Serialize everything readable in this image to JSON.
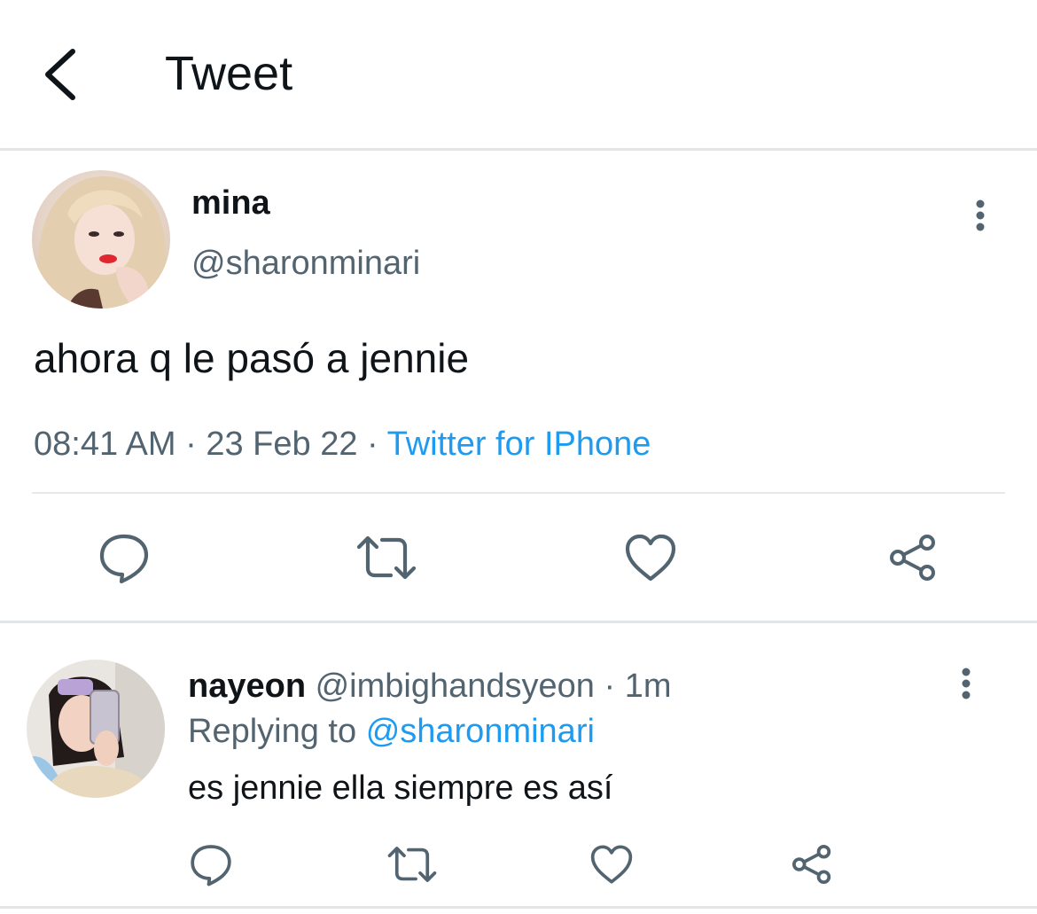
{
  "header": {
    "title": "Tweet",
    "back_icon": "back-arrow-icon"
  },
  "main_tweet": {
    "author_name": "mina",
    "author_handle": "@sharonminari",
    "text": "ahora q le pasó a jennie",
    "time": "08:41 AM",
    "date": "23 Feb 22",
    "separator": "·",
    "source": "Twitter for IPhone",
    "actions": [
      "reply-icon",
      "retweet-icon",
      "like-icon",
      "share-icon"
    ]
  },
  "reply": {
    "author_name": "nayeon",
    "author_handle": "@imbighandsyeon",
    "separator": "·",
    "time": "1m",
    "replying_prefix": "Replying to",
    "replying_to": "@sharonminari",
    "text": "es jennie ella siempre es así",
    "actions": [
      "reply-icon",
      "retweet-icon",
      "like-icon",
      "share-icon"
    ]
  },
  "colors": {
    "text": "#0f1419",
    "secondary": "#536471",
    "accent": "#1d9bf0",
    "divider": "#e3e6e8"
  }
}
